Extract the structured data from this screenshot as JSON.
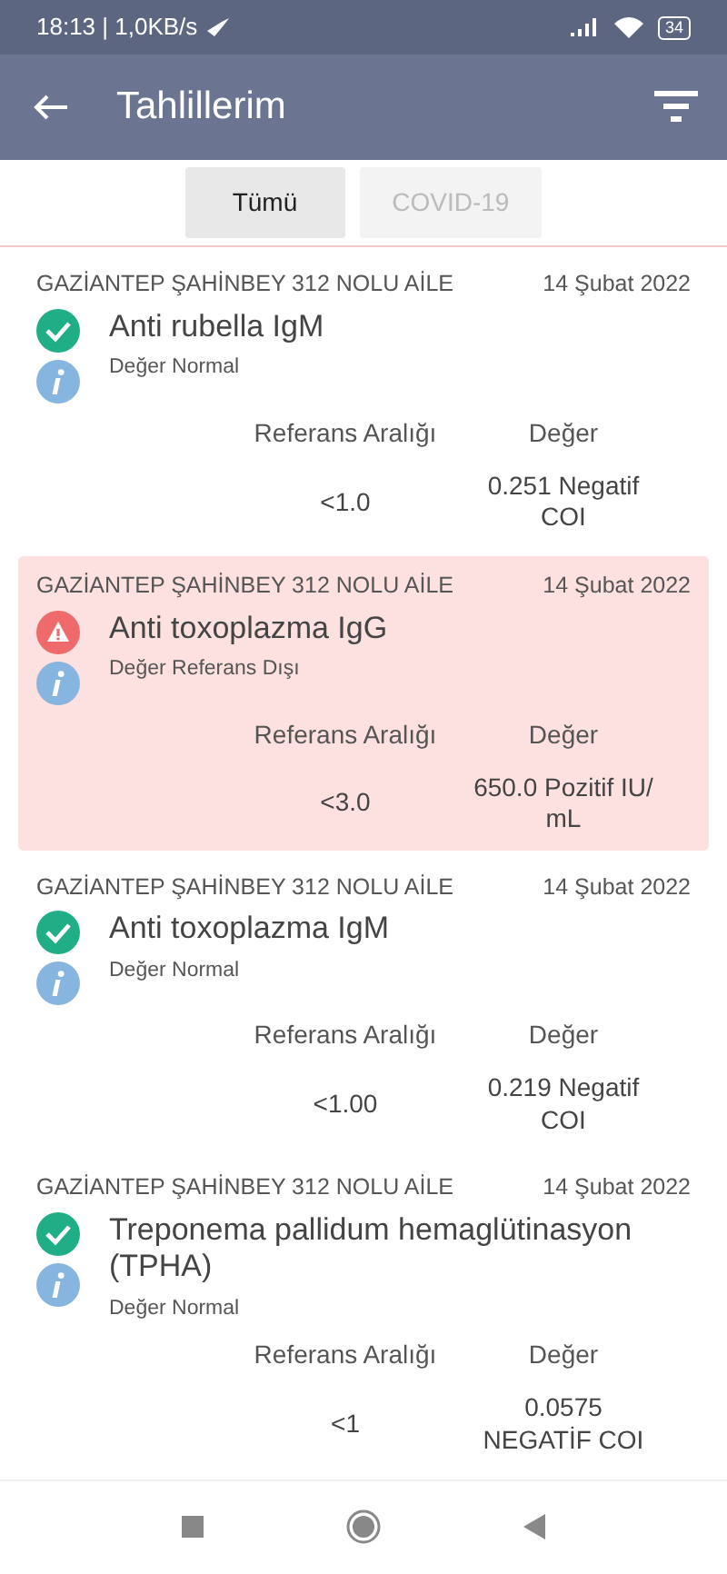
{
  "status_bar": {
    "time": "18:13 | 1,0KB/s",
    "battery": "34"
  },
  "app_bar": {
    "title": "Tahlillerim"
  },
  "tabs": [
    {
      "label": "Tümü",
      "selected": true
    },
    {
      "label": "COVID-19",
      "selected": false
    }
  ],
  "results": [
    {
      "org": "GAZİANTEP ŞAHİNBEY 312 NOLU AİLE",
      "date": "14 Şubat 2022",
      "title": "Anti rubella IgM",
      "kind": "normal",
      "note": "Değer Normal",
      "ref_label": "Referans Aralığı",
      "value_label": "Değer",
      "ref": "<1.0",
      "value": "0.251 Negatif COI"
    },
    {
      "org": "GAZİANTEP ŞAHİNBEY 312 NOLU AİLE",
      "date": "14 Şubat 2022",
      "title": "Anti toxoplazma IgG",
      "kind": "alert",
      "note": "Değer Referans Dışı",
      "ref_label": "Referans Aralığı",
      "value_label": "Değer",
      "ref": "<3.0",
      "value": "650.0 Pozitif IU/ mL"
    },
    {
      "org": "GAZİANTEP ŞAHİNBEY 312 NOLU AİLE",
      "date": "14 Şubat 2022",
      "title": "Anti toxoplazma IgM",
      "kind": "normal",
      "note": "Değer Normal",
      "ref_label": "Referans Aralığı",
      "value_label": "Değer",
      "ref": "<1.00",
      "value": "0.219 Negatif COI"
    },
    {
      "org": "GAZİANTEP ŞAHİNBEY 312 NOLU AİLE",
      "date": "14 Şubat 2022",
      "title": "Treponema pallidum hemaglütinasyon (TPHA)",
      "kind": "normal",
      "note": "Değer Normal",
      "ref_label": "Referans Aralığı",
      "value_label": "Değer",
      "ref": "<1",
      "value": "0.0575 NEGATİF COI"
    }
  ]
}
